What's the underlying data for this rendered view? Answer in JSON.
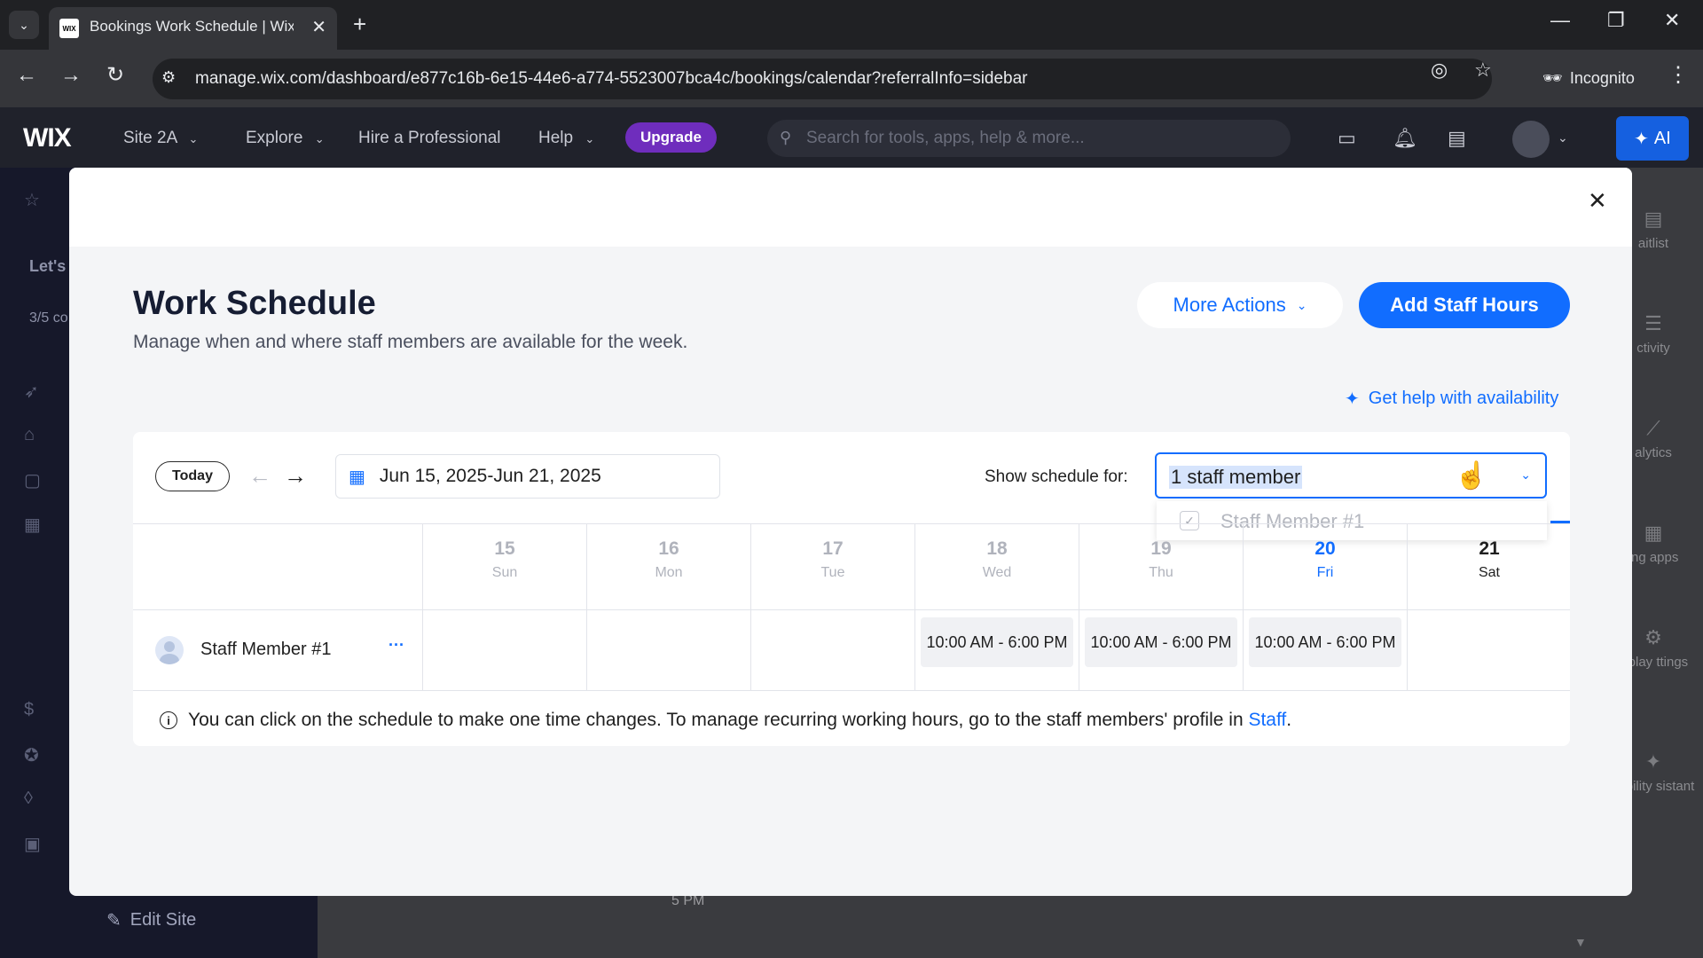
{
  "browser": {
    "tab_title": "Bookings Work Schedule | Wix",
    "favicon_text": "WIX",
    "url": "manage.wix.com/dashboard/e877c16b-6e15-44e6-a774-5523007bca4c/bookings/calendar?referralInfo=sidebar",
    "incognito_label": "Incognito"
  },
  "wix_bar": {
    "logo": "WIX",
    "site_menu": "Site 2A",
    "explore": "Explore",
    "hire": "Hire a Professional",
    "help": "Help",
    "upgrade": "Upgrade",
    "search_placeholder": "Search for tools, apps, help & more...",
    "ai_label": "AI"
  },
  "background": {
    "lets_text": "Let's",
    "progress_text": "3/5 co",
    "edit_site": "Edit Site",
    "time_label": "5 PM",
    "right_rail": [
      {
        "icon": "clipboard-icon",
        "label": "aitlist"
      },
      {
        "icon": "list-icon",
        "label": "ctivity"
      },
      {
        "icon": "chart-icon",
        "label": "alytics"
      },
      {
        "icon": "apps-icon",
        "label": "ing apps"
      },
      {
        "icon": "gear-icon",
        "label": "isplay ttings"
      },
      {
        "icon": "sparkle-icon",
        "label": "ilability sistant"
      }
    ]
  },
  "modal": {
    "title": "Work Schedule",
    "subtitle": "Manage when and where staff members are available for the week.",
    "more_actions": "More Actions",
    "add_staff_hours": "Add Staff Hours",
    "help_link": "Get help with availability",
    "toolbar": {
      "today": "Today",
      "date_range": "Jun 15, 2025-Jun 21, 2025",
      "show_schedule_label": "Show schedule for:",
      "staff_select_value": "1 staff member",
      "dropdown_option": "Staff Member #1"
    },
    "days": [
      {
        "num": "15",
        "name": "Sun",
        "state": "muted"
      },
      {
        "num": "16",
        "name": "Mon",
        "state": "muted"
      },
      {
        "num": "17",
        "name": "Tue",
        "state": "muted"
      },
      {
        "num": "18",
        "name": "Wed",
        "state": "muted"
      },
      {
        "num": "19",
        "name": "Thu",
        "state": "muted"
      },
      {
        "num": "20",
        "name": "Fri",
        "state": "today"
      },
      {
        "num": "21",
        "name": "Sat",
        "state": "active"
      }
    ],
    "staff_row": {
      "name": "Staff Member #1",
      "more": "···",
      "slots": [
        "",
        "",
        "",
        "10:00 AM - 6:00 PM",
        "10:00 AM - 6:00 PM",
        "10:00 AM - 6:00 PM",
        ""
      ]
    },
    "info": {
      "text": "You can click on the schedule to make one time changes. To manage recurring working hours, go to the staff members' profile in ",
      "link": "Staff",
      "end": "."
    }
  },
  "colors": {
    "accent": "#116dff",
    "upgrade": "#6f2dbd",
    "ai_button": "#1560e0",
    "modal_bg": "#f4f5f7"
  }
}
